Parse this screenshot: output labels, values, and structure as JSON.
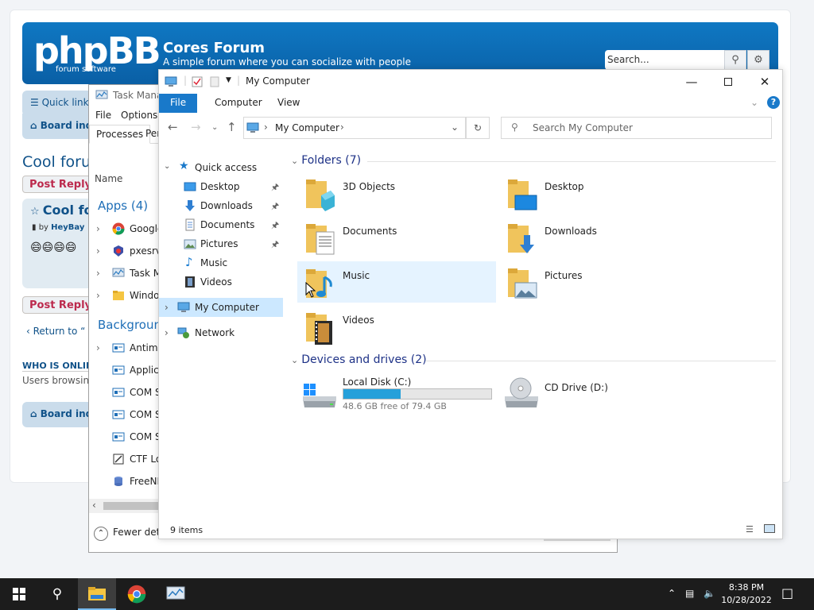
{
  "forum": {
    "logo": "phpBB",
    "logo_sub": "forum  software",
    "title": "Cores Forum",
    "description": "A simple forum where you can socialize with people",
    "search_placeholder": "Search...",
    "quick_links": "Quick links",
    "board_index": "Board index",
    "forum_name": "Cool forum",
    "post_reply": "Post Reply",
    "post_title": "Cool fo",
    "post_by_prefix": "by",
    "post_author": "HeyBay",
    "smileys": "😄😄😄😄",
    "return_link": "Return to “",
    "who_online": "WHO IS ONLINE",
    "users_browsing": "Users browsing"
  },
  "task_manager": {
    "title": "Task Manag",
    "menu": [
      "File",
      "Options"
    ],
    "tabs": [
      "Processes",
      "Per"
    ],
    "name_header": "Name",
    "apps_group": "Apps (4)",
    "apps": [
      {
        "label": "Google",
        "icon": "chrome-icon"
      },
      {
        "label": "pxesrv",
        "icon": "shield-icon"
      },
      {
        "label": "Task M",
        "icon": "task-manager-icon"
      },
      {
        "label": "Windo",
        "icon": "folder-icon"
      }
    ],
    "background_group": "Backgroun",
    "background": [
      {
        "label": "Antima",
        "icon": "process-icon"
      },
      {
        "label": "Applic",
        "icon": "process-icon"
      },
      {
        "label": "COM S",
        "icon": "process-icon"
      },
      {
        "label": "COM S",
        "icon": "process-icon"
      },
      {
        "label": "COM S",
        "icon": "process-icon"
      },
      {
        "label": "CTF Lo",
        "icon": "ctf-icon"
      },
      {
        "label": "FreeNF",
        "icon": "database-icon"
      }
    ],
    "fewer_details": "Fewer det"
  },
  "explorer": {
    "title": "My Computer",
    "ribbon_tabs": [
      "File",
      "Computer",
      "View"
    ],
    "address": "My Computer",
    "search_placeholder": "Search My Computer",
    "nav": {
      "quick_access": "Quick access",
      "pinned": [
        "Desktop",
        "Downloads",
        "Documents",
        "Pictures"
      ],
      "unpinned": [
        "Music",
        "Videos"
      ],
      "my_computer": "My Computer",
      "network": "Network"
    },
    "folders_header": "Folders (7)",
    "folders": [
      "3D Objects",
      "Desktop",
      "Documents",
      "Downloads",
      "Music",
      "Pictures",
      "Videos"
    ],
    "devices_header": "Devices and drives (2)",
    "drives": [
      {
        "label": "Local Disk (C:)",
        "free": "48.6 GB free of 79.4 GB",
        "used_fraction": 0.388
      },
      {
        "label": "CD Drive (D:)"
      }
    ],
    "status": "9 items"
  },
  "taskbar": {
    "time": "8:38 PM",
    "date": "10/28/2022"
  },
  "colors": {
    "accent": "#1979ca",
    "forum_header": "#0f78c3",
    "taskbar": "#1c1c1c",
    "selection": "#cce8ff"
  }
}
